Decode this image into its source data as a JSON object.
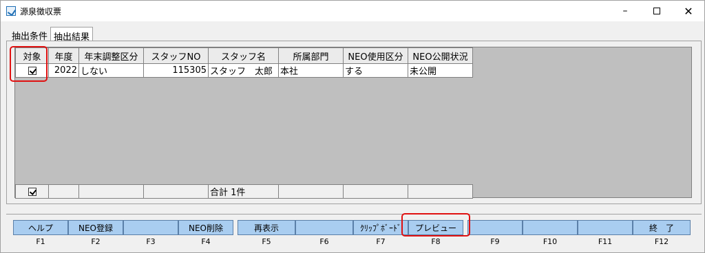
{
  "window": {
    "title": "源泉徴収票",
    "minimize": "–",
    "close": "✕"
  },
  "tabs": [
    {
      "label": "抽出条件"
    },
    {
      "label": "抽出結果"
    }
  ],
  "grid": {
    "columns": [
      "対象",
      "年度",
      "年末調整区分",
      "スタッフNO",
      "スタッフ名",
      "所属部門",
      "NEO使用区分",
      "NEO公開状況"
    ],
    "rows": [
      {
        "checked": true,
        "year": "2022",
        "adjust": "しない",
        "staff_no": "115305",
        "staff_name": "スタッフ　太郎",
        "dept": "本社",
        "neo_use": "する",
        "neo_status": "未公開"
      }
    ],
    "footer": {
      "checked": true,
      "total": "合計 1件"
    }
  },
  "fkeys": [
    {
      "label": "ヘルプ",
      "key": "F1"
    },
    {
      "label": "NEO登録",
      "key": "F2"
    },
    {
      "label": "",
      "key": "F3"
    },
    {
      "label": "NEO削除",
      "key": "F4"
    },
    {
      "label": "再表示",
      "key": "F5"
    },
    {
      "label": "",
      "key": "F6"
    },
    {
      "label": "ｸﾘｯﾌﾟﾎﾞｰﾄﾞ",
      "key": "F7"
    },
    {
      "label": "プレビュー",
      "key": "F8"
    },
    {
      "label": "",
      "key": "F9"
    },
    {
      "label": "",
      "key": "F10"
    },
    {
      "label": "",
      "key": "F11"
    },
    {
      "label": "終　了",
      "key": "F12"
    }
  ],
  "colors": {
    "highlight": "#e01010",
    "fkey_bg": "#a9cdf0",
    "grid_bg": "#bfbfbf"
  }
}
